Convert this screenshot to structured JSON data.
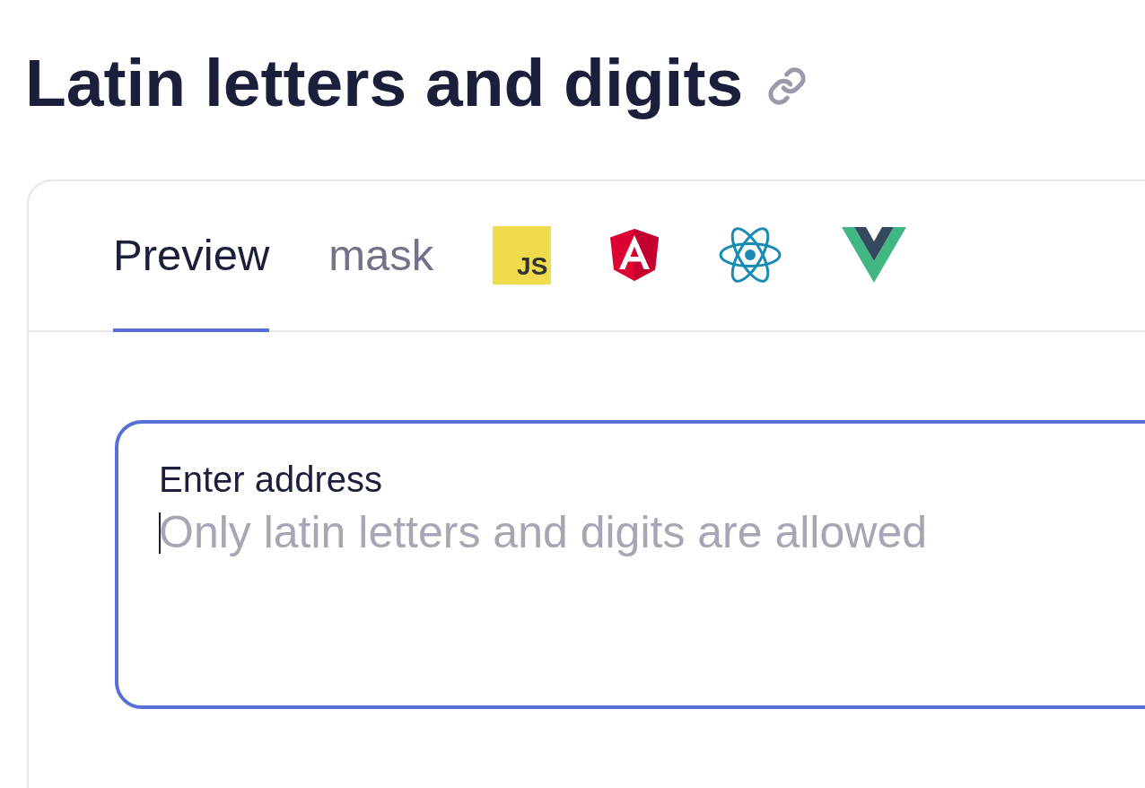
{
  "heading": {
    "title": "Latin letters and digits"
  },
  "tabs": [
    {
      "kind": "text",
      "label": "Preview",
      "selected": true
    },
    {
      "kind": "text",
      "label": "mask",
      "selected": false
    },
    {
      "kind": "js",
      "label": "JS",
      "selected": false
    },
    {
      "kind": "angular",
      "selected": false
    },
    {
      "kind": "react",
      "selected": false
    },
    {
      "kind": "vue",
      "selected": false
    }
  ],
  "field": {
    "label": "Enter address",
    "placeholder": "Only latin letters and digits are allowed",
    "focused": true
  }
}
